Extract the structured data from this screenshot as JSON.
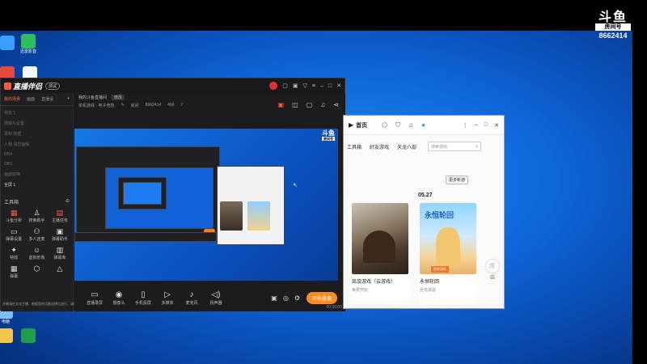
{
  "watermark": {
    "logo": "斗鱼",
    "tag": "房间号",
    "room": "8662414"
  },
  "desktop_icons": [
    {
      "label": ""
    },
    {
      "label": "迅雷影音"
    },
    {
      "label": ""
    },
    {
      "label": ""
    },
    {
      "label": "电脑"
    },
    {
      "label": ""
    },
    {
      "label": ""
    },
    {
      "label": ""
    }
  ],
  "stream_app": {
    "logo": "直播伴侣",
    "beta": "测试",
    "sidebar": {
      "tabs": [
        "我的场景",
        "画面",
        "直播设"
      ],
      "items": [
        "场景 1",
        "摄像头设置",
        "录制 数据",
        "人物 消息面板",
        "RBA",
        "OBS",
        "画面转换",
        "全屏 1"
      ],
      "section_title": "工具箱",
      "tools": [
        {
          "label": "斗鱼分析"
        },
        {
          "label": "搜索助手"
        },
        {
          "label": "主播任务"
        },
        {
          "label": "弹幕设置"
        },
        {
          "label": "多人连麦"
        },
        {
          "label": "弹幕助手"
        },
        {
          "label": "特效"
        },
        {
          "label": "虚拟形象"
        },
        {
          "label": "弹幕库"
        },
        {
          "label": "弹幕"
        },
        {
          "label": ""
        },
        {
          "label": ""
        }
      ],
      "footer": "开播请在文化主播，根据您的设备选择后进行，请您提前做好设备"
    },
    "header": {
      "title": "我的斗鱼直播间",
      "edit": "修改",
      "category": "单机游戏 · 电子竞技",
      "room_label": "房间",
      "room": "8662414",
      "fans": "499",
      "likes": "7"
    },
    "bottom": {
      "buttons": [
        "直播录屏",
        "摄像头",
        "手机投屏",
        "多媒体",
        "麦克风",
        "扬声器"
      ],
      "go_live": "开始直播",
      "status": "00:00:00"
    }
  },
  "launcher": {
    "title": "首页",
    "nav": [
      "工具箱",
      "好友游戏",
      "天龙八部"
    ],
    "search_placeholder": "搜索游戏",
    "more": "更多新游",
    "date": "05.27",
    "cards": [
      {
        "name": "凯旋游戏（云游戏）",
        "sub": "免费开玩"
      },
      {
        "name": "永恒轮回",
        "sub": "抢先体验",
        "tag": "首发测试"
      }
    ]
  }
}
